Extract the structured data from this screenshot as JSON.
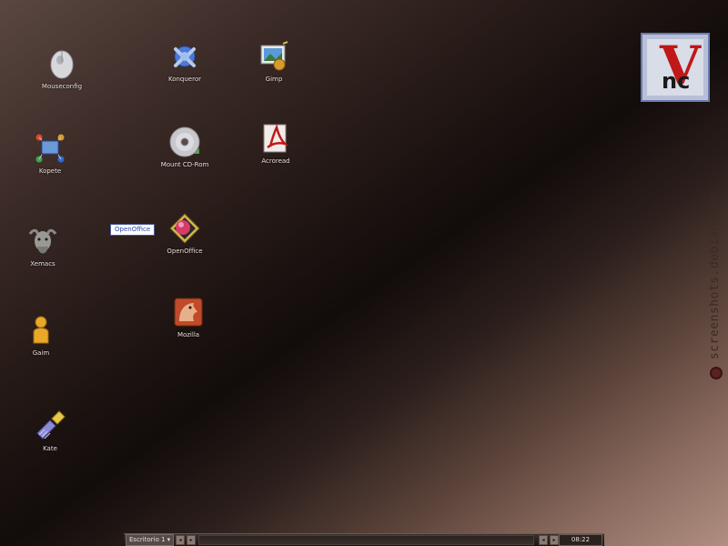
{
  "desktop": {
    "icons": [
      {
        "label": "Mouseconfig",
        "icon": "mouse-icon"
      },
      {
        "label": "Konqueror",
        "icon": "konqueror-icon"
      },
      {
        "label": "Gimp",
        "icon": "gimp-icon"
      },
      {
        "label": "Kopete",
        "icon": "kopete-icon"
      },
      {
        "label": "Mount CD-Rom",
        "icon": "cdrom-icon"
      },
      {
        "label": "Acroread",
        "icon": "acroread-icon"
      },
      {
        "label": "Xemacs",
        "icon": "gnu-icon"
      },
      {
        "label": "OpenOffice",
        "icon": "openoffice-icon"
      },
      {
        "label": "Gaim",
        "icon": "gaim-icon"
      },
      {
        "label": "Mozilla",
        "icon": "mozilla-icon"
      },
      {
        "label": "Kate",
        "icon": "kate-icon"
      }
    ],
    "tooltip": "OpenOffice"
  },
  "vnc_logo": {
    "v": "V",
    "nc": "nc"
  },
  "watermark": "screenshots.debian.net",
  "taskbar": {
    "desktop_label": "Escritorio 1",
    "prev_label": "◂",
    "next_label": "▸",
    "clock": "08:22"
  },
  "colors": {
    "logo_red": "#c01818",
    "tooltip_text": "#3047a0"
  }
}
